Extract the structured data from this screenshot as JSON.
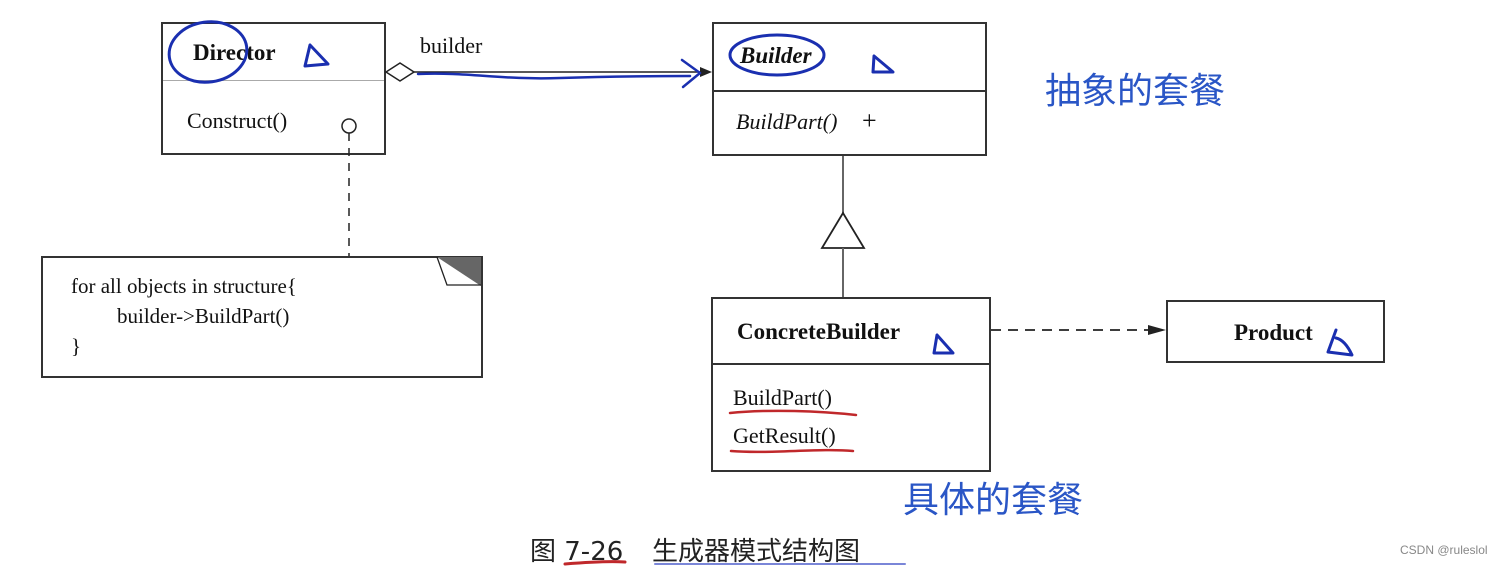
{
  "diagram": {
    "caption_number": "图 7-26",
    "caption_title": "生成器模式结构图",
    "watermark": "CSDN @ruleslol",
    "classes": {
      "director": {
        "name": "Director",
        "methods": [
          "Construct()"
        ]
      },
      "builder": {
        "name": "Builder",
        "methods": [
          "BuildPart()"
        ],
        "abstract": true,
        "method_marker": "+"
      },
      "concrete_builder": {
        "name": "ConcreteBuilder",
        "methods": [
          "BuildPart()",
          "GetResult()"
        ]
      },
      "product": {
        "name": "Product",
        "methods": []
      }
    },
    "association_label": "builder",
    "note": {
      "lines": [
        "for all objects in structure{",
        "builder->BuildPart()",
        "}"
      ]
    },
    "annotations": {
      "abstract_label": "抽象的套餐",
      "concrete_label": "具体的套餐",
      "annotation_color": "#2a56c6",
      "pen_blue": "#1a2fb0",
      "pen_red": "#c0282b"
    },
    "relations": [
      {
        "from": "Director",
        "to": "Builder",
        "type": "aggregation"
      },
      {
        "from": "ConcreteBuilder",
        "to": "Builder",
        "type": "generalization"
      },
      {
        "from": "ConcreteBuilder",
        "to": "Product",
        "type": "dependency"
      },
      {
        "from": "Director.Construct()",
        "to": "note",
        "type": "note-link"
      }
    ]
  }
}
